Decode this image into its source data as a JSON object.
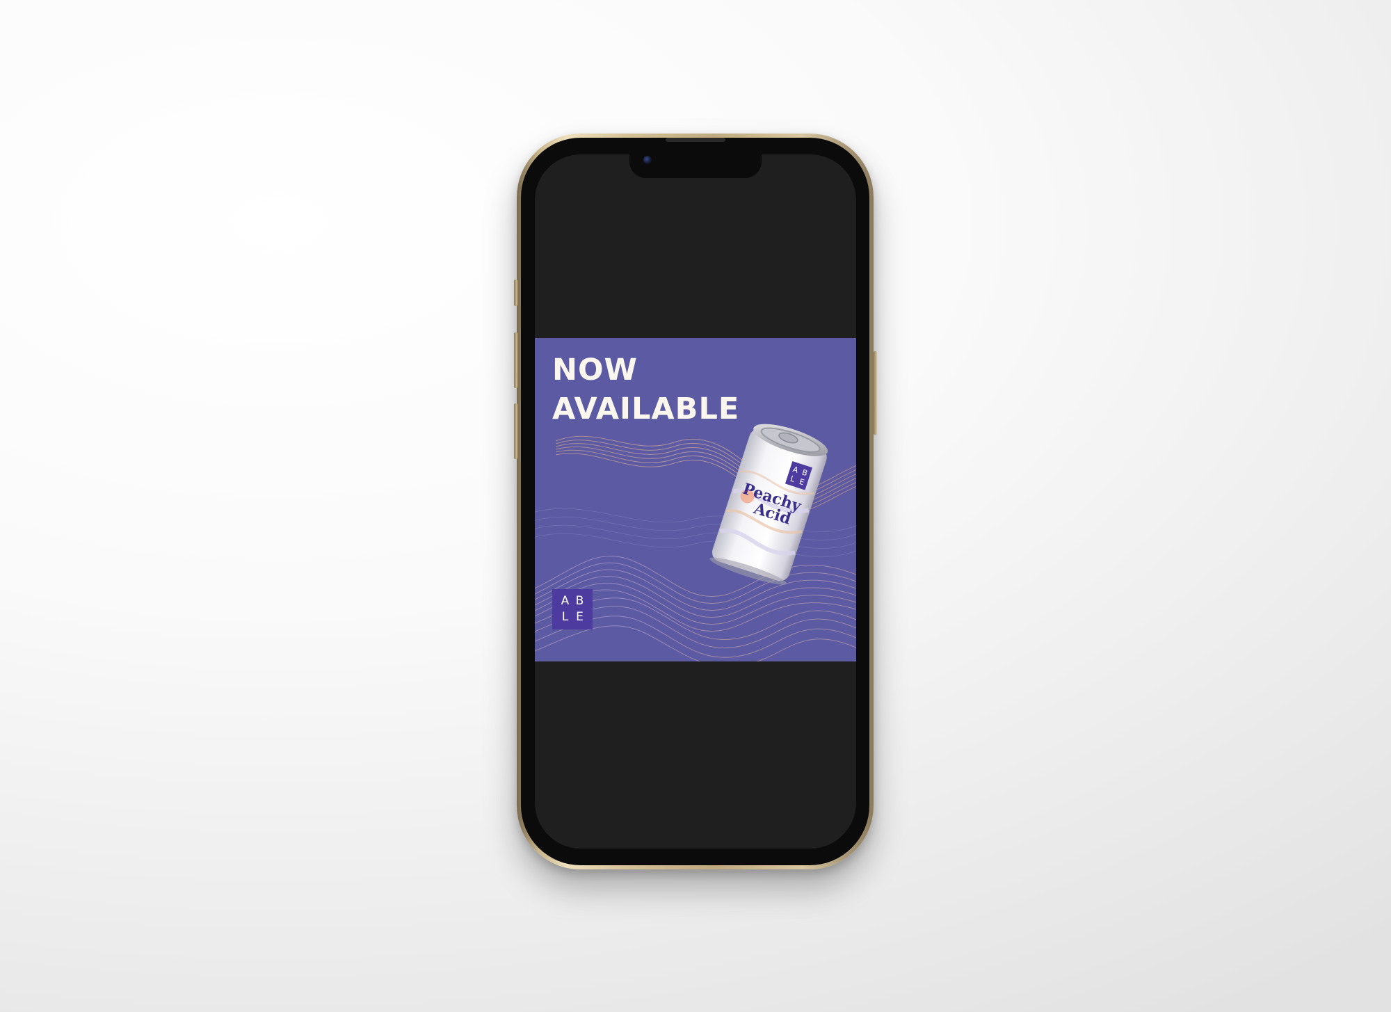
{
  "device": {
    "model": "smartphone",
    "frame_color": "#d6c29a",
    "screen_color": "#1f1f1f"
  },
  "ad": {
    "background_color": "#5b5aa3",
    "headline": [
      "NOW",
      "AVAILABLE"
    ],
    "logo": {
      "letters": [
        "A",
        "B",
        "L",
        "E"
      ],
      "color": "#4d3ba0"
    },
    "product": {
      "name_line1": "Peachy",
      "name_line2": "Acid",
      "can_logo_letters": [
        "A",
        "B",
        "L",
        "E"
      ]
    }
  }
}
